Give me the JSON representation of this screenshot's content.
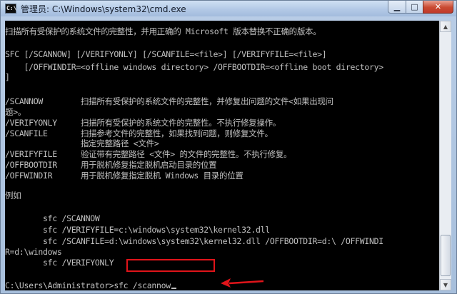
{
  "window": {
    "title": "管理员: C:\\Windows\\system32\\cmd.exe",
    "icon_text": "C:\\",
    "minimize_glyph": "▁",
    "maximize_glyph": "□",
    "close_glyph": "✕"
  },
  "console": {
    "lines": [
      "扫描所有受保护的系统文件的完整性，并用正确的 Microsoft 版本替换不正确的版本。",
      "",
      "SFC [/SCANNOW] [/VERIFYONLY] [/SCANFILE=<file>] [/VERIFYFILE=<file>]",
      "    [/OFFWINDIR=<offline windows directory> /OFFBOOTDIR=<offline boot directory>",
      "]",
      "",
      "/SCANNOW        扫描所有受保护的系统文件的完整性，并修复出问题的文件<如果出现问",
      "题>。",
      "/VERIFYONLY     扫描所有受保护的系统文件的完整性。不执行修复操作。",
      "/SCANFILE       扫描参考文件的完整性，如果找到问题，则修复文件。",
      "                指定完整路径 <文件>",
      "/VERIFYFILE     验证带有完整路径 <文件> 的文件的完整性。不执行修复。",
      "/OFFBOOTDIR     用于脱机修复指定脱机启动目录的位置",
      "/OFFWINDIR      用于脱机修复指定脱机 Windows 目录的位置",
      "",
      "例如",
      "",
      "        sfc /SCANNOW",
      "        sfc /VERIFYFILE=c:\\windows\\system32\\kernel32.dll",
      "        sfc /SCANFILE=d:\\windows\\system32\\kernel32.dll /OFFBOOTDIR=d:\\ /OFFWINDI",
      "R=d:\\windows",
      "        sfc /VERIFYONLY",
      "",
      "",
      ""
    ],
    "prompt": "C:\\Users\\Administrator>",
    "command": "sfc /scannow"
  },
  "annotation": {
    "color": "#e0141a"
  }
}
